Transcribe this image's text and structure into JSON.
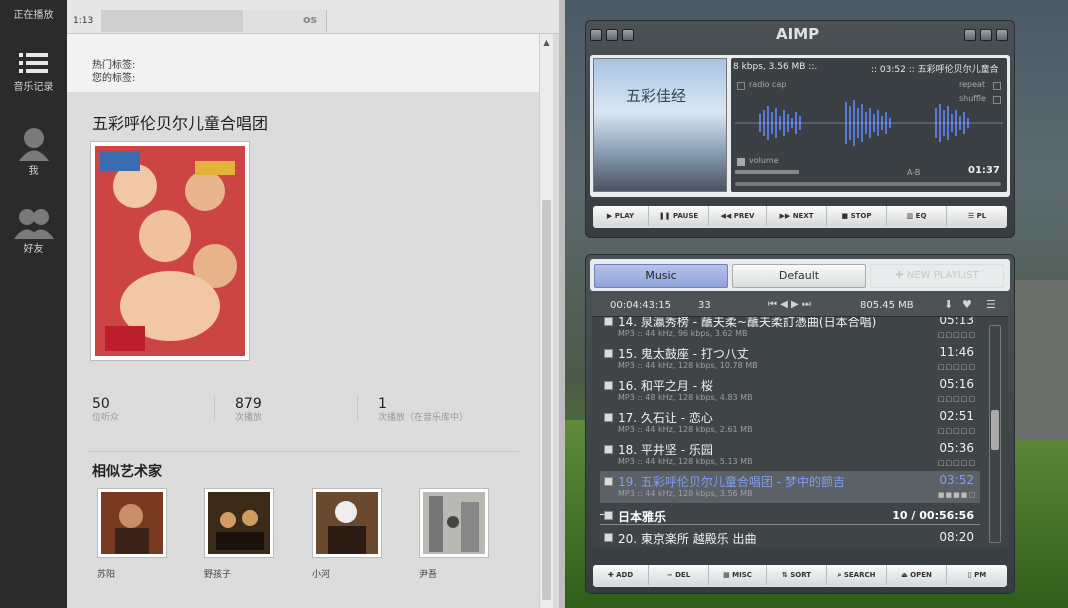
{
  "sidebar": {
    "now_playing": "正在播放",
    "music_log": "音乐记录",
    "me": "我",
    "friends": "好友"
  },
  "main": {
    "time": "1:13",
    "lastfm_logo": "os",
    "hot_tags": "热门标签:",
    "your_tags": "您的标签:",
    "artist_name": "五彩呼伦贝尔儿童合唱团",
    "stats": [
      {
        "value": "50",
        "label": "位听众"
      },
      {
        "value": "879",
        "label": "次播放"
      },
      {
        "value": "1",
        "label": "次播放（在音乐库中）"
      }
    ],
    "similar_title": "相似艺术家",
    "similar": [
      {
        "name": "苏阳"
      },
      {
        "name": "野孩子"
      },
      {
        "name": "小河"
      },
      {
        "name": "尹吾"
      }
    ]
  },
  "aimp": {
    "title": "AIMP",
    "info_line": "8 kbps, 3.56 MB ::.",
    "info_right": ":: 03:52 :: 五彩呼伦贝尔儿童合",
    "radio_cap": "radio cap",
    "repeat": "repeat",
    "shuffle": "shuffle",
    "volume": "volume",
    "ab": "A-B",
    "elapsed": "01:37",
    "controls": [
      "PLAY",
      "PAUSE",
      "PREV",
      "NEXT",
      "STOP",
      "EQ",
      "PL"
    ],
    "tabs": [
      "Music",
      "Default",
      "NEW PLAYLIST"
    ],
    "pl_total_time": "00:04:43:15",
    "pl_count": "33",
    "pl_size": "805.45 MB",
    "tracks": [
      {
        "title": "14. 泉瀛秀榜 - 蘸夫柔~蘸夫柔訂憑曲(日本合唱)",
        "info": "MP3 :: 44 kHz, 96 kbps, 3.62 MB",
        "dur": "05:13"
      },
      {
        "title": "15. 鬼太鼓座 - 打つ八丈",
        "info": "MP3 :: 44 kHz, 128 kbps, 10.78 MB",
        "dur": "11:46"
      },
      {
        "title": "16. 和平之月 - 桜",
        "info": "MP3 :: 48 kHz, 128 kbps, 4.83 MB",
        "dur": "05:16"
      },
      {
        "title": "17. 久石让 - 恋心",
        "info": "MP3 :: 44 kHz, 128 kbps, 2.61 MB",
        "dur": "02:51"
      },
      {
        "title": "18. 平井坚 - 乐园",
        "info": "MP3 :: 44 kHz, 128 kbps, 5.13 MB",
        "dur": "05:36"
      },
      {
        "title": "19. 五彩呼伦贝尔儿童合唱团 - 梦中的额吉",
        "info": "MP3 :: 44 kHz, 128 kbps, 3.56 MB",
        "dur": "03:52"
      }
    ],
    "group_name": "日本雅乐",
    "group_info": "10 / 00:56:56",
    "next_track": "20. 東京楽所 越殿乐 出曲",
    "next_dur": "08:20",
    "bottom_controls": [
      "ADD",
      "DEL",
      "MISC",
      "SORT",
      "SEARCH",
      "OPEN",
      "PM"
    ],
    "colors": {
      "accent": "#8fa3d9",
      "playing": "#7f9ff0"
    }
  }
}
